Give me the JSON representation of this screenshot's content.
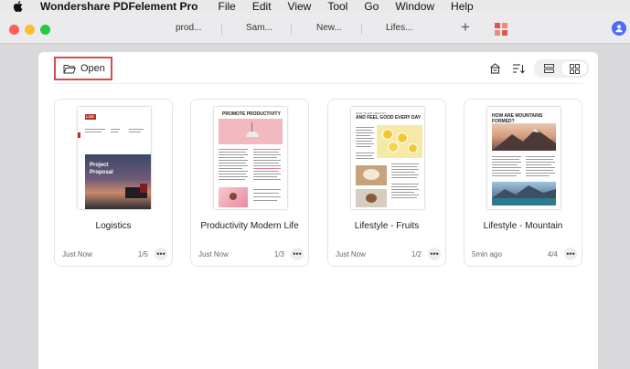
{
  "menubar": {
    "app_name": "Wondershare PDFelement Pro",
    "items": [
      "File",
      "Edit",
      "View",
      "Tool",
      "Go",
      "Window",
      "Help"
    ]
  },
  "tabs": [
    "prod...",
    "Sam...",
    "New...",
    "Lifes..."
  ],
  "toolbar": {
    "open_label": "Open"
  },
  "documents": [
    {
      "title": "Logistics",
      "time": "Just Now",
      "pages": "1/5",
      "thumb_text": {
        "logo": "LOG",
        "heading": "Project Proposal"
      }
    },
    {
      "title": "Productivity Modern Life",
      "time": "Just Now",
      "pages": "1/3",
      "thumb_text": {
        "heading": "PROMOTE PRODUCTIVITY"
      }
    },
    {
      "title": "Lifestyle - Fruits",
      "time": "Just Now",
      "pages": "1/2",
      "thumb_text": {
        "kicker": "HOW TO EAT HEALTHY",
        "heading": "AND FEEL GOOD EVERY DAY"
      }
    },
    {
      "title": "Lifestyle - Mountain",
      "time": "5min ago",
      "pages": "4/4",
      "thumb_text": {
        "heading": "HOW ARE MOUNTAINS FORMED?"
      }
    }
  ],
  "more_glyph": "•••",
  "colors": {
    "accent_red": "#d94a4a",
    "avatar_blue": "#4a6cf7"
  }
}
